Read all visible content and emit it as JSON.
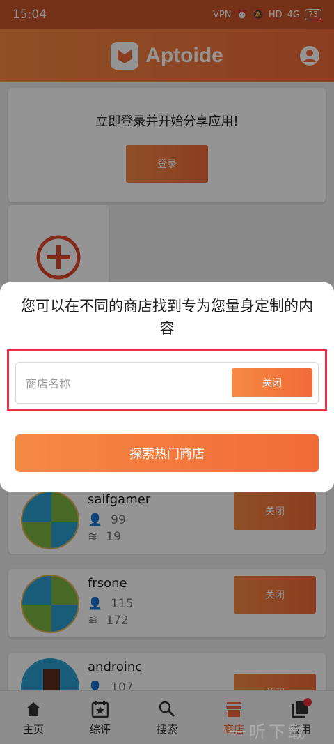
{
  "status_bar": {
    "time": "15:04",
    "vpn": "VPN",
    "hd": "HD",
    "signal": "4G",
    "battery": "73"
  },
  "header": {
    "app_name": "Aptoide"
  },
  "login_card": {
    "message": "立即登录并开始分享应用!",
    "button_label": "登录"
  },
  "dialog": {
    "message": "您可以在不同的商店找到专为您量身定制的内容",
    "search_placeholder": "商店名称",
    "close_label": "关闭",
    "explore_label": "探索热门商店"
  },
  "stores": [
    {
      "name": "saifgamer",
      "followers": "99",
      "apps": "19",
      "button_label": "关闭"
    },
    {
      "name": "frsone",
      "followers": "115",
      "apps": "172",
      "button_label": "关闭"
    },
    {
      "name": "androinc",
      "followers": "107",
      "apps": "",
      "button_label": "关闭"
    }
  ],
  "bottom_nav": [
    {
      "label": "主页",
      "icon": "home-icon"
    },
    {
      "label": "综评",
      "icon": "calendar-star-icon"
    },
    {
      "label": "搜索",
      "icon": "search-icon"
    },
    {
      "label": "商店",
      "icon": "store-icon"
    },
    {
      "label": "应用",
      "icon": "apps-icon"
    }
  ],
  "watermark": "一听下载",
  "colors": {
    "accent": "#f26a38",
    "accent_light": "#f58a43",
    "highlight": "#e63241",
    "status_bar": "#c8552a"
  }
}
